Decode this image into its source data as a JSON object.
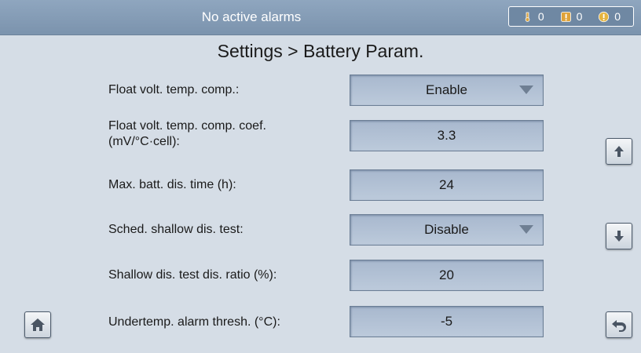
{
  "header": {
    "status_text": "No active alarms",
    "alarms": [
      {
        "icon": "minor-alarm-icon",
        "count": "0"
      },
      {
        "icon": "major-alarm-icon",
        "count": "0"
      },
      {
        "icon": "critical-alarm-icon",
        "count": "0"
      }
    ]
  },
  "page": {
    "title": "Settings > Battery Param."
  },
  "params": [
    {
      "label": "Float volt. temp. comp.:",
      "value": "Enable",
      "type": "dropdown"
    },
    {
      "label": "Float volt. temp. comp. coef.\n(mV/°C·cell):",
      "value": "3.3",
      "type": "input"
    },
    {
      "label": "Max. batt. dis. time (h):",
      "value": "24",
      "type": "input"
    },
    {
      "label": "Sched. shallow dis. test:",
      "value": "Disable",
      "type": "dropdown"
    },
    {
      "label": "Shallow dis. test dis. ratio (%):",
      "value": "20",
      "type": "input"
    },
    {
      "label": "Undertemp. alarm thresh. (°C):",
      "value": "-5",
      "type": "input"
    }
  ],
  "nav": {
    "scroll_up_icon": "arrow-up-icon",
    "scroll_down_icon": "arrow-down-icon",
    "home_icon": "home-icon",
    "back_icon": "back-icon"
  },
  "colors": {
    "background": "#d5dde6",
    "header": "#7f97b1",
    "field": "#b3c3d6"
  }
}
